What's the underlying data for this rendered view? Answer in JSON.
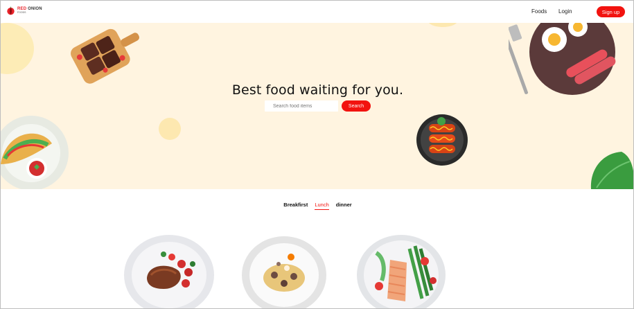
{
  "navbar": {
    "logo": {
      "title_red": "RED",
      "title_dark": "ONION",
      "subtitle": "FOODS"
    },
    "links": {
      "foods": "Foods",
      "login": "Login"
    },
    "signup_label": "Sign up"
  },
  "hero": {
    "title": "Best food waiting for you.",
    "search": {
      "placeholder": "Search food items",
      "button_label": "Search"
    }
  },
  "tabs": [
    {
      "label": "Breakfirst",
      "active": false
    },
    {
      "label": "Lunch",
      "active": true
    },
    {
      "label": "dinner",
      "active": false
    }
  ],
  "colors": {
    "accent": "#f2130f",
    "hero_bg": "#fff4e0"
  },
  "icons": {
    "logo": "onion-icon"
  },
  "dishes": [
    {
      "image": "steak-plate"
    },
    {
      "image": "pasta-plate"
    },
    {
      "image": "salmon-asparagus-plate"
    }
  ]
}
